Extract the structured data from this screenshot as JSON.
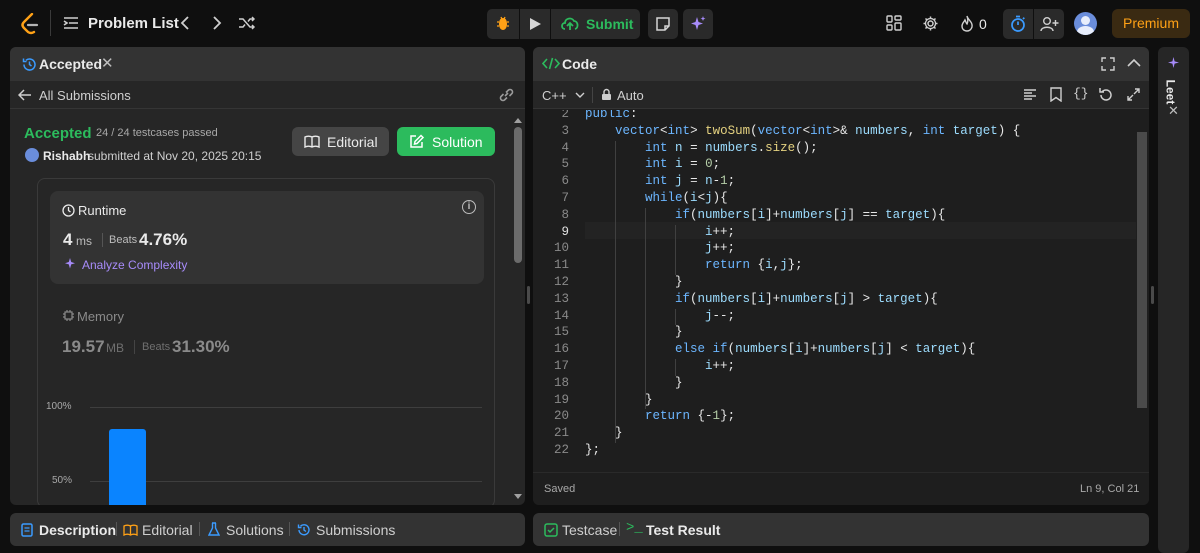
{
  "topbar": {
    "problem_list": "Problem List",
    "submit_label": "Submit",
    "streak_count": "0",
    "premium_label": "Premium"
  },
  "left": {
    "tab_title": "Accepted",
    "back_label": "All Submissions",
    "status": "Accepted",
    "testcases": "24 / 24 testcases passed",
    "user": "Rishabh",
    "submitted_at": "submitted at Nov 20, 2025 20:15",
    "editorial_btn": "Editorial",
    "solution_btn": "Solution",
    "runtime_label": "Runtime",
    "runtime_value": "4",
    "runtime_unit": "ms",
    "beats_label": "Beats",
    "runtime_beats": "4.76%",
    "analyze_label": "Analyze Complexity",
    "memory_label": "Memory",
    "memory_value": "19.57",
    "memory_unit": "MB",
    "memory_beats": "31.30%",
    "chart_tick_100": "100%",
    "chart_tick_50": "50%"
  },
  "chart_data": {
    "type": "bar",
    "ylim": [
      0,
      100
    ],
    "yticks": [
      "100%",
      "50%"
    ],
    "values": [
      85
    ],
    "color": "#0a84ff"
  },
  "code_panel": {
    "title": "Code",
    "language": "C++",
    "mode": "Auto",
    "saved": "Saved",
    "cursor": "Ln 9, Col 21"
  },
  "sidebar_right": {
    "label": "Leet"
  },
  "bottom_left_tabs": [
    "Description",
    "Editorial",
    "Solutions",
    "Submissions"
  ],
  "bottom_right_tabs": [
    "Testcase",
    "Test Result"
  ],
  "code_lines": [
    {
      "n": "2",
      "t": "public:"
    },
    {
      "n": "3",
      "t": "    vector<int> twoSum(vector<int>& numbers, int target) {"
    },
    {
      "n": "4",
      "t": "        int n = numbers.size();"
    },
    {
      "n": "5",
      "t": "        int i = 0;"
    },
    {
      "n": "6",
      "t": "        int j = n-1;"
    },
    {
      "n": "7",
      "t": "        while(i<j){"
    },
    {
      "n": "8",
      "t": "            if(numbers[i]+numbers[j] == target){"
    },
    {
      "n": "9",
      "t": "                i++;"
    },
    {
      "n": "10",
      "t": "                j++;"
    },
    {
      "n": "11",
      "t": "                return {i,j};"
    },
    {
      "n": "12",
      "t": "            }"
    },
    {
      "n": "13",
      "t": "            if(numbers[i]+numbers[j] > target){"
    },
    {
      "n": "14",
      "t": "                j--;"
    },
    {
      "n": "15",
      "t": "            }"
    },
    {
      "n": "16",
      "t": "            else if(numbers[i]+numbers[j] < target){"
    },
    {
      "n": "17",
      "t": "                i++;"
    },
    {
      "n": "18",
      "t": "            }"
    },
    {
      "n": "19",
      "t": "        }"
    },
    {
      "n": "20",
      "t": "        return {-1};"
    },
    {
      "n": "21",
      "t": "    }"
    },
    {
      "n": "22",
      "t": "};"
    }
  ]
}
